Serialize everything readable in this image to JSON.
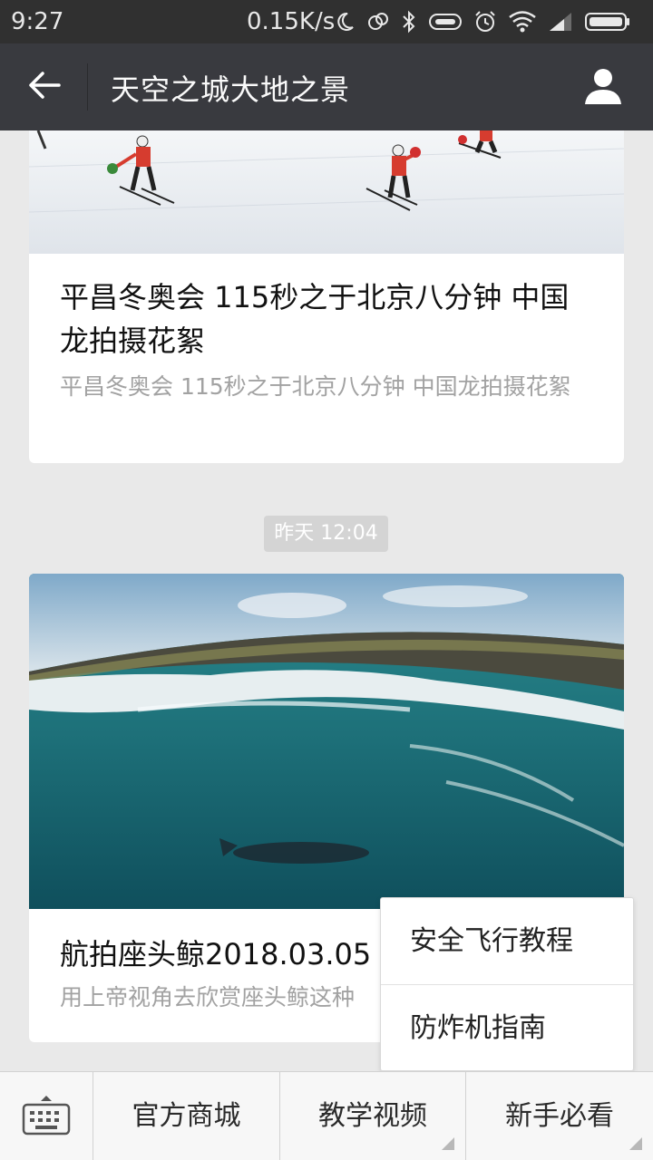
{
  "status_bar": {
    "time": "9:27",
    "speed": "0.15K/s",
    "icons": [
      "moon-icon",
      "sync-icon",
      "bluetooth-icon",
      "headset-icon",
      "alarm-icon",
      "wifi-icon",
      "signal-icon",
      "battery-icon"
    ]
  },
  "header": {
    "title": "天空之城大地之景",
    "back_icon": "back-arrow-icon",
    "profile_icon": "user-profile-icon"
  },
  "articles": [
    {
      "title": "平昌冬奥会  115秒之于北京八分钟  中国龙拍摄花絮",
      "description": "平昌冬奥会  115秒之于北京八分钟  中国龙拍摄花絮"
    },
    {
      "title": "航拍座头鲸2018.03.05",
      "description": "用上帝视角去欣赏座头鲸这种"
    }
  ],
  "timestamp": "昨天 12:04",
  "popup_menu": {
    "items": [
      "安全飞行教程",
      "防炸机指南"
    ]
  },
  "bottom_menu": {
    "keyboard_icon": "keyboard-icon",
    "items": [
      "官方商城",
      "教学视频",
      "新手必看"
    ]
  },
  "colors": {
    "status_bar": "#303030",
    "title_bar": "#393a3f",
    "background": "#e9e9e9",
    "card": "#ffffff",
    "secondary_text": "#a2a2a2"
  }
}
